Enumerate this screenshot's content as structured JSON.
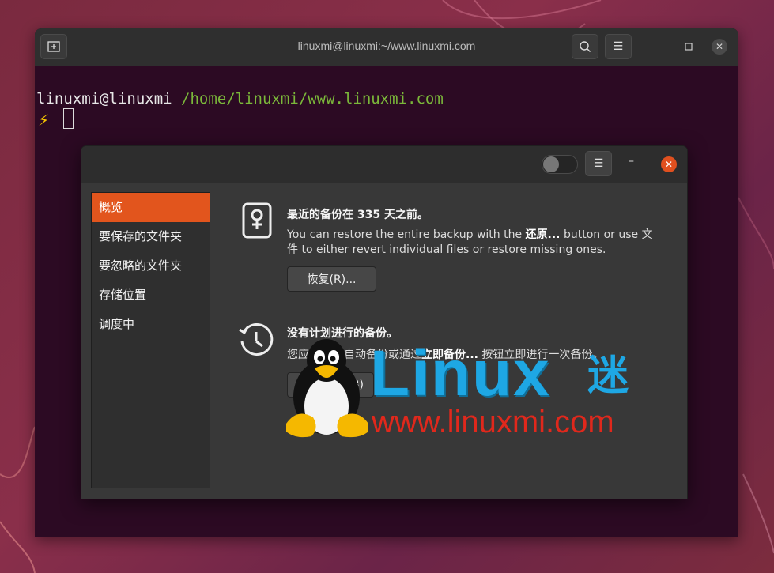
{
  "terminal": {
    "title": "linuxmi@linuxmi:~/www.linuxmi.com",
    "new_tab_icon": "new-tab-icon",
    "search_icon": "search-icon",
    "menu_icon": "hamburger-menu-icon",
    "prompt_user": "linuxmi@linuxmi",
    "prompt_path": "/home/linuxmi/www.linuxmi.com",
    "prompt_symbol": "⚡"
  },
  "backup_dialog": {
    "sidebar": [
      {
        "label": "概览"
      },
      {
        "label": "要保存的文件夹"
      },
      {
        "label": "要忽略的文件夹"
      },
      {
        "label": "存储位置"
      },
      {
        "label": "调度中"
      }
    ],
    "restore": {
      "heading": "最近的备份在 335 天之前。",
      "text_before": "You can restore the entire backup with the ",
      "text_bold": "还原...",
      "text_after": " button or use 文件 to either revert individual files or restore missing ones.",
      "button_label": "恢复(R)..."
    },
    "schedule": {
      "heading": "没有计划进行的备份。",
      "text_before": "您应",
      "text_mid": "自动备份或通过",
      "text_bold": "立即备份...",
      "text_after": " 按钮立即进行一次备份。",
      "button_label": "B)"
    }
  },
  "watermark": {
    "brand": "Linux",
    "brand_cn": "迷",
    "url": "www.linuxmi.com"
  },
  "colors": {
    "accent": "#e2551d",
    "prompt_path": "#7bb83a",
    "logo_blue": "#1ea7e4",
    "logo_red": "#e0281c"
  }
}
